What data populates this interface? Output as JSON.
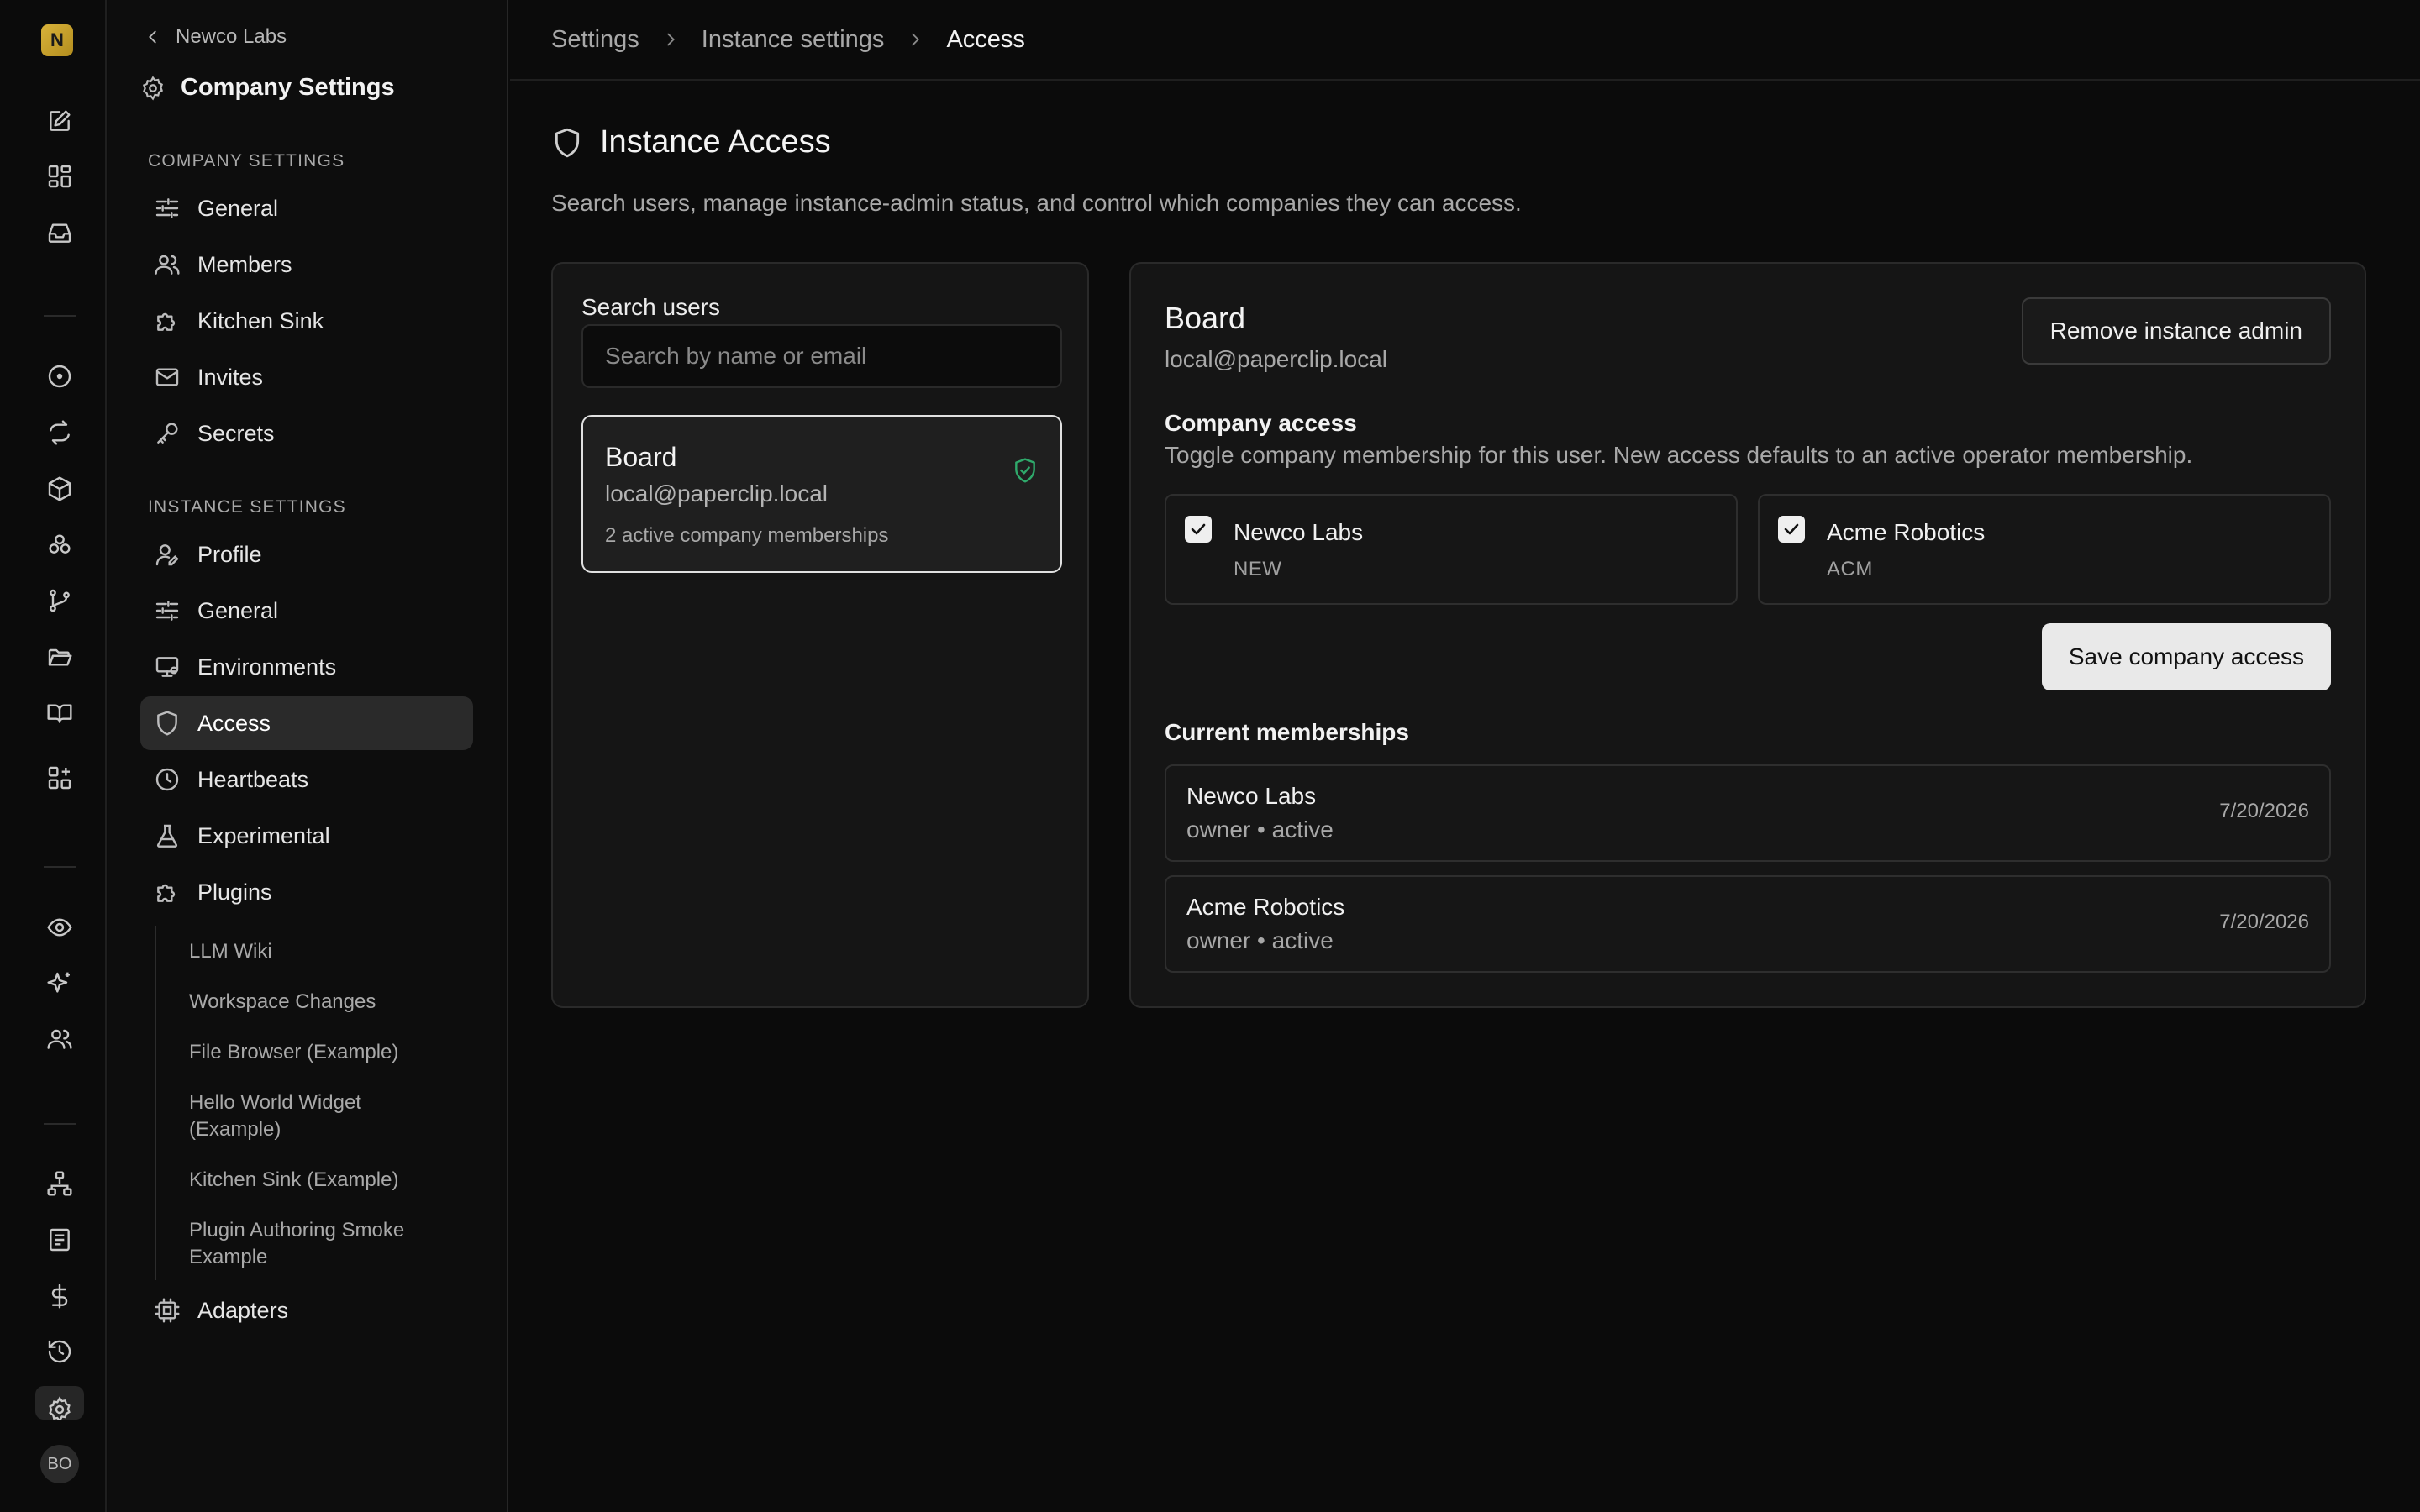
{
  "workspace": {
    "logo_letter": "N",
    "avatar_initials": "BO"
  },
  "sidebar": {
    "back_label": "Newco Labs",
    "title": "Company Settings",
    "company_section": "COMPANY SETTINGS",
    "company_items": [
      {
        "label": "General",
        "icon": "sliders-icon"
      },
      {
        "label": "Members",
        "icon": "users-icon"
      },
      {
        "label": "Kitchen Sink",
        "icon": "puzzle-icon"
      },
      {
        "label": "Invites",
        "icon": "mail-icon"
      },
      {
        "label": "Secrets",
        "icon": "key-icon"
      }
    ],
    "instance_section": "INSTANCE SETTINGS",
    "instance_items": [
      {
        "label": "Profile",
        "icon": "user-pen-icon"
      },
      {
        "label": "General",
        "icon": "sliders-icon"
      },
      {
        "label": "Environments",
        "icon": "monitor-icon"
      },
      {
        "label": "Access",
        "icon": "shield-icon",
        "active": true
      },
      {
        "label": "Heartbeats",
        "icon": "clock-icon"
      },
      {
        "label": "Experimental",
        "icon": "flask-icon"
      },
      {
        "label": "Plugins",
        "icon": "puzzle-icon"
      }
    ],
    "plugins": [
      "LLM Wiki",
      "Workspace Changes",
      "File Browser (Example)",
      "Hello World Widget (Example)",
      "Kitchen Sink (Example)",
      "Plugin Authoring Smoke Example"
    ],
    "adapters_label": "Adapters"
  },
  "breadcrumb": {
    "items": [
      "Settings",
      "Instance settings",
      "Access"
    ]
  },
  "page": {
    "title": "Instance Access",
    "description": "Search users, manage instance-admin status, and control which companies they can access."
  },
  "search": {
    "label": "Search users",
    "placeholder": "Search by name or email",
    "value": ""
  },
  "users": [
    {
      "name": "Board",
      "email": "local@paperclip.local",
      "memberships_text": "2 active company memberships",
      "is_admin": true,
      "selected": true
    }
  ],
  "detail": {
    "name": "Board",
    "email": "local@paperclip.local",
    "remove_admin_label": "Remove instance admin",
    "company_access_title": "Company access",
    "company_access_help": "Toggle company membership for this user. New access defaults to an active operator membership.",
    "companies": [
      {
        "name": "Newco Labs",
        "code": "NEW",
        "checked": true
      },
      {
        "name": "Acme Robotics",
        "code": "ACM",
        "checked": true
      }
    ],
    "save_label": "Save company access",
    "memberships_title": "Current memberships",
    "memberships": [
      {
        "company": "Newco Labs",
        "role_status": "owner • active",
        "date": "7/20/2026"
      },
      {
        "company": "Acme Robotics",
        "role_status": "owner • active",
        "date": "7/20/2026"
      }
    ]
  },
  "colors": {
    "background": "#0b0b0b",
    "panel": "#151515",
    "border": "#2a2a2a",
    "admin_badge": "#2fa96b",
    "primary_button": "#e9e9e9"
  }
}
